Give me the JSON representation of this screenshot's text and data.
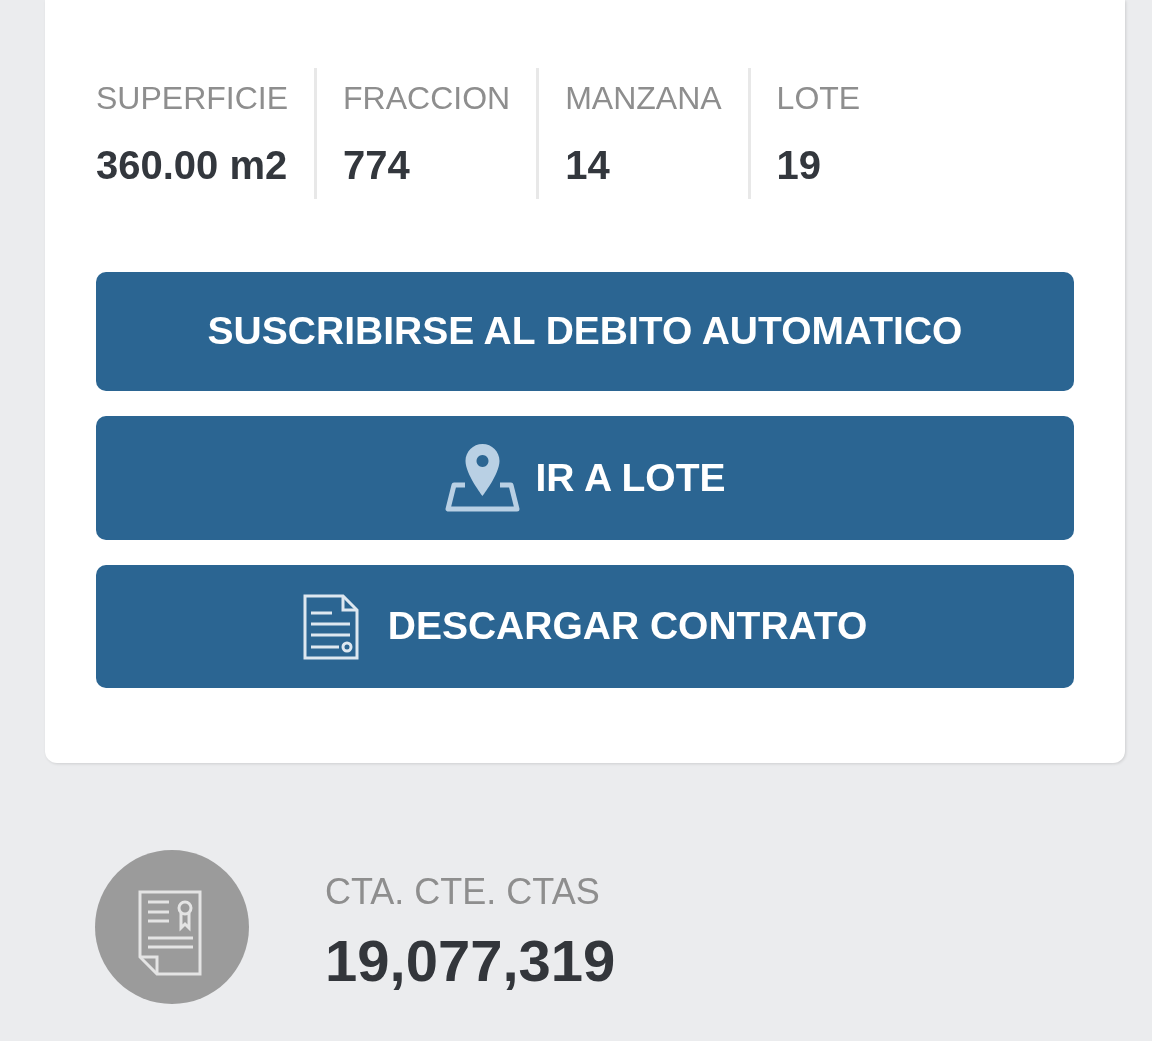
{
  "stats": [
    {
      "label": "SUPERFICIE",
      "value": "360.00 m2"
    },
    {
      "label": "FRACCION",
      "value": "774"
    },
    {
      "label": "MANZANA",
      "value": "14"
    },
    {
      "label": "LOTE",
      "value": "19"
    }
  ],
  "buttons": [
    {
      "kind": "plain",
      "label": "SUSCRIBIRSE AL DEBITO AUTOMATICO"
    },
    {
      "kind": "location",
      "label": "IR A LOTE"
    },
    {
      "kind": "document",
      "label": "DESCARGAR CONTRATO"
    }
  ],
  "account": {
    "label": "CTA. CTE. CTAS",
    "value": "19,077,319"
  }
}
